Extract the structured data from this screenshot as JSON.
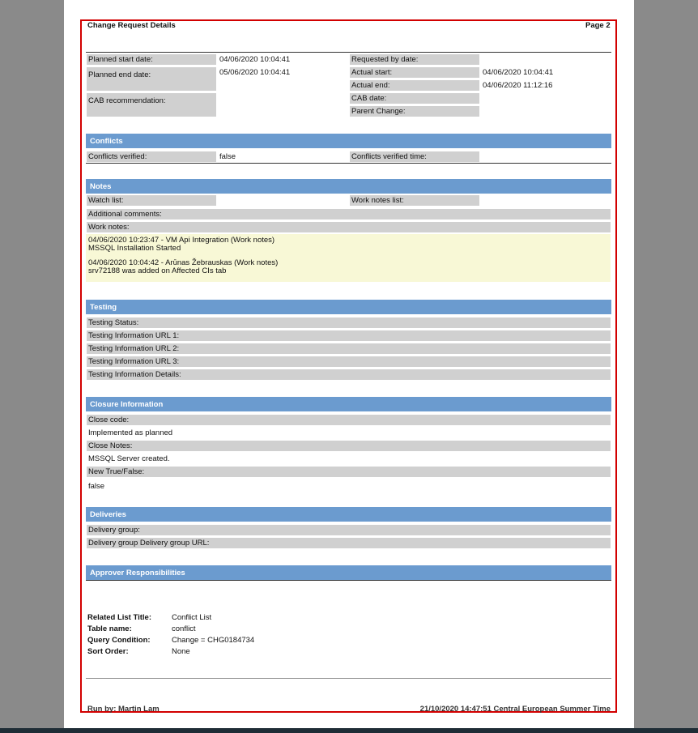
{
  "header": {
    "title": "Change Request Details",
    "page": "Page 2"
  },
  "top_fields": {
    "planned_start": {
      "label": "Planned start date:",
      "value": "04/06/2020 10:04:41"
    },
    "planned_end": {
      "label": "Planned end date:",
      "value": "05/06/2020 10:04:41"
    },
    "cab_recommendation": {
      "label": "CAB recommendation:",
      "value": ""
    },
    "requested_by": {
      "label": "Requested by date:",
      "value": ""
    },
    "actual_start": {
      "label": "Actual start:",
      "value": "04/06/2020 10:04:41"
    },
    "actual_end": {
      "label": "Actual end:",
      "value": "04/06/2020 11:12:16"
    },
    "cab_date": {
      "label": "CAB date:",
      "value": ""
    },
    "parent_change": {
      "label": "Parent Change:",
      "value": ""
    }
  },
  "conflicts": {
    "title": "Conflicts",
    "verified_label": "Conflicts verified:",
    "verified_value": "false",
    "time_label": "Conflicts verified time:",
    "time_value": ""
  },
  "notes": {
    "title": "Notes",
    "watch_list_label": "Watch list:",
    "work_notes_list_label": "Work notes list:",
    "additional_comments_label": "Additional comments:",
    "work_notes_label": "Work notes:",
    "entries": [
      {
        "header": "04/06/2020 10:23:47 - VM Api Integration (Work notes)",
        "body": "MSSQL Installation Started"
      },
      {
        "header": "04/06/2020 10:04:42 - Arūnas Žebrauskas (Work notes)",
        "body": "srv72188 was added on Affected CIs tab"
      }
    ]
  },
  "testing": {
    "title": "Testing",
    "fields": [
      "Testing Status:",
      "Testing Information URL 1:",
      "Testing Information URL 2:",
      "Testing Information URL 3:",
      "Testing Information Details:"
    ]
  },
  "closure": {
    "title": "Closure Information",
    "close_code_label": "Close code:",
    "close_code_value": "Implemented as planned",
    "close_notes_label": "Close Notes:",
    "close_notes_value": "MSSQL Server created.",
    "new_tf_label": "New True/False:",
    "new_tf_value": "false"
  },
  "deliveries": {
    "title": "Deliveries",
    "group_label": "Delivery group:",
    "url_label": "Delivery group Delivery group URL:"
  },
  "approver": {
    "title": "Approver Responsibilities"
  },
  "related_list": {
    "title_label": "Related List Title:",
    "title_value": "Conflict List",
    "table_label": "Table name:",
    "table_value": "conflict",
    "query_label": "Query Condition:",
    "query_value": "Change = CHG0184734",
    "sort_label": "Sort Order:",
    "sort_value": "None"
  },
  "footer": {
    "run_by": "Run by: Martin Lam",
    "timestamp": "21/10/2020 14:47:51 Central European Summer Time"
  },
  "colors": {
    "section_header": "#6b9bcf",
    "label_bg": "#d0d0d0",
    "notes_bg": "#f8f8d6",
    "frame": "#d20000"
  }
}
